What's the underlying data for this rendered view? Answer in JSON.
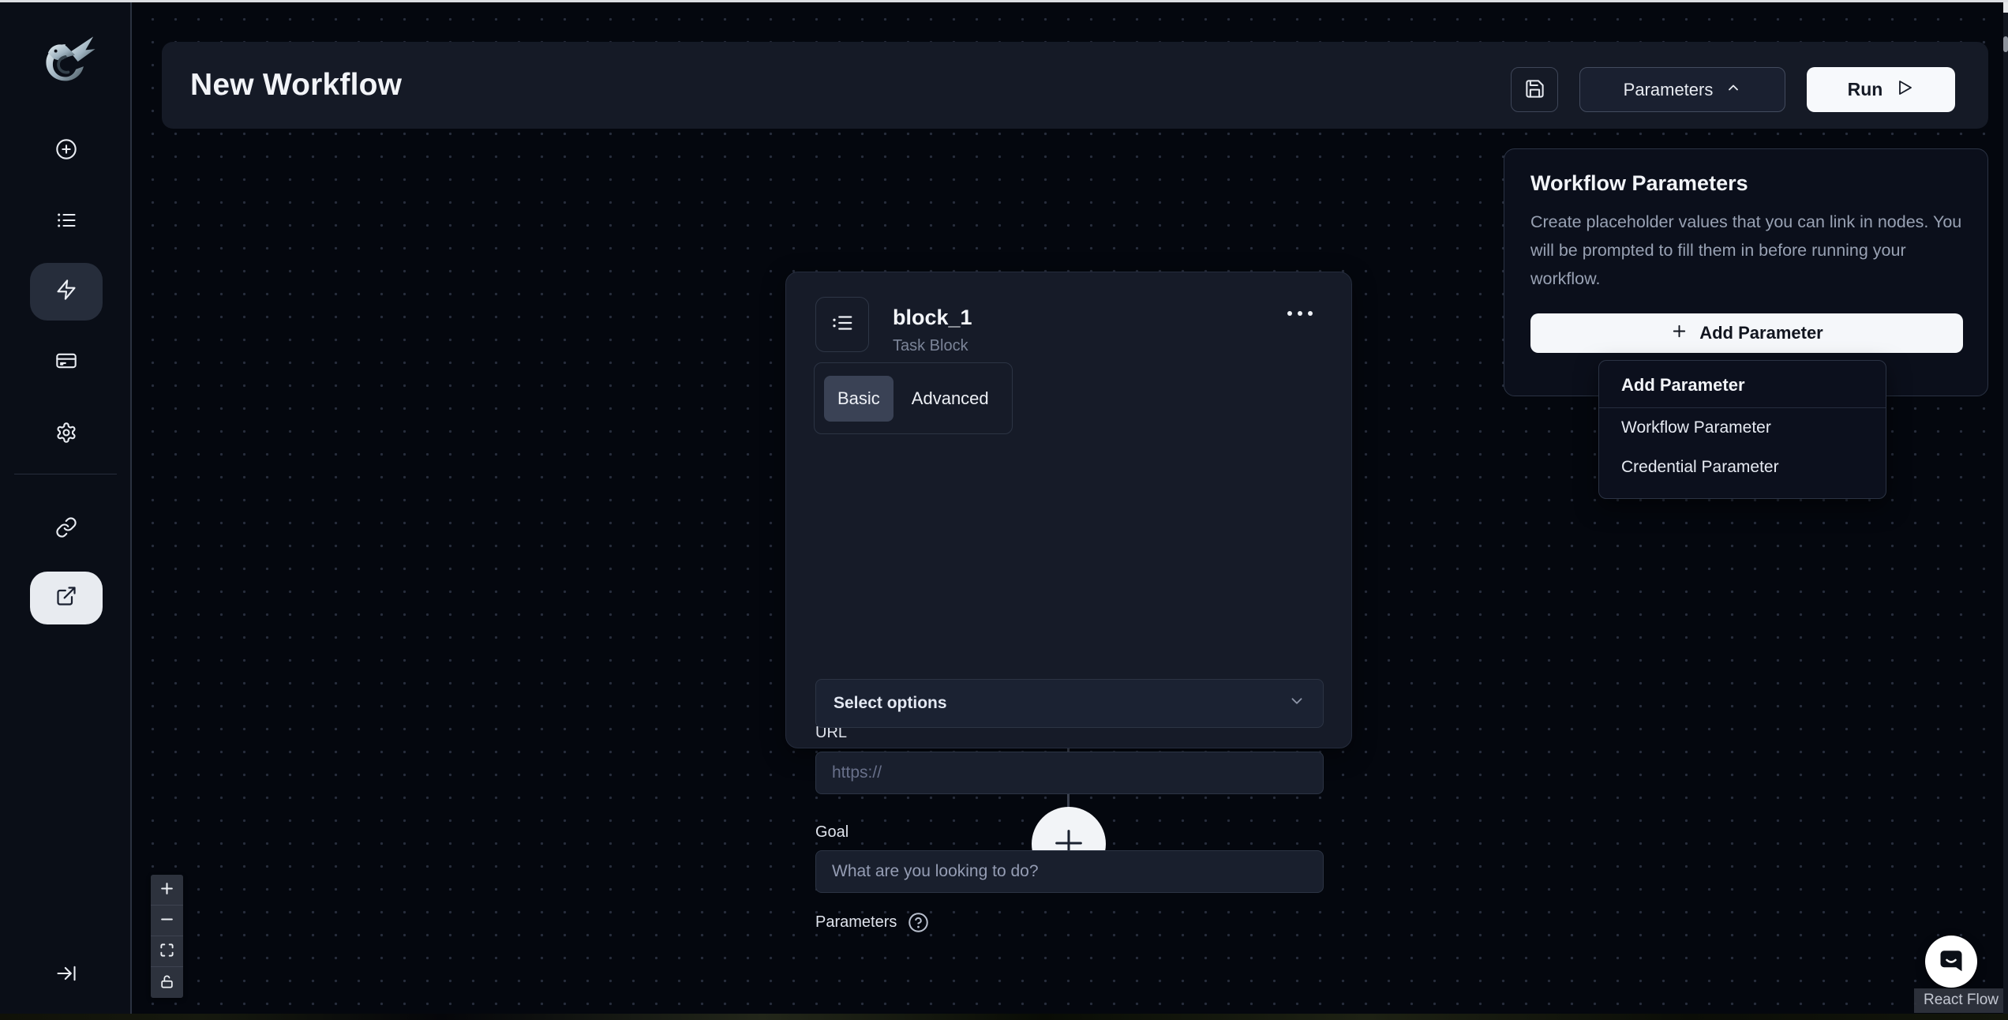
{
  "header": {
    "title": "New Workflow",
    "parameters_button": "Parameters",
    "run_button": "Run"
  },
  "sidebar": {
    "icons": [
      "dragon-logo",
      "plus-circle",
      "list",
      "lightning",
      "credit-card",
      "gear",
      "link",
      "external-link",
      "collapse-arrow"
    ],
    "active_primary": "lightning",
    "active_secondary": "external-link"
  },
  "node": {
    "name": "block_1",
    "type_label": "Task Block",
    "tabs": [
      {
        "label": "Basic",
        "selected": true
      },
      {
        "label": "Advanced",
        "selected": false
      }
    ],
    "url_label": "URL",
    "url_placeholder": "https://",
    "goal_label": "Goal",
    "goal_placeholder": "What are you looking to do?",
    "parameters_label": "Parameters",
    "parameters_select_placeholder": "Select options"
  },
  "parameters_panel": {
    "title": "Workflow Parameters",
    "description": "Create placeholder values that you can link in nodes. You will be prompted to fill them in before running your workflow.",
    "add_button": "Add Parameter"
  },
  "add_parameter_menu": {
    "title": "Add Parameter",
    "items": [
      {
        "label": "Workflow Parameter"
      },
      {
        "label": "Credential Parameter"
      }
    ]
  },
  "attribution": "React Flow",
  "colors": {
    "canvas_bg": "#04070e",
    "surface": "#151a26",
    "node_bg": "#161b28",
    "panel_bg": "#0b0f1b",
    "border": "#2c3444",
    "selected_tab": "#3a4255",
    "light_button": "#f5f7fa",
    "muted_text": "#98a1b3"
  }
}
